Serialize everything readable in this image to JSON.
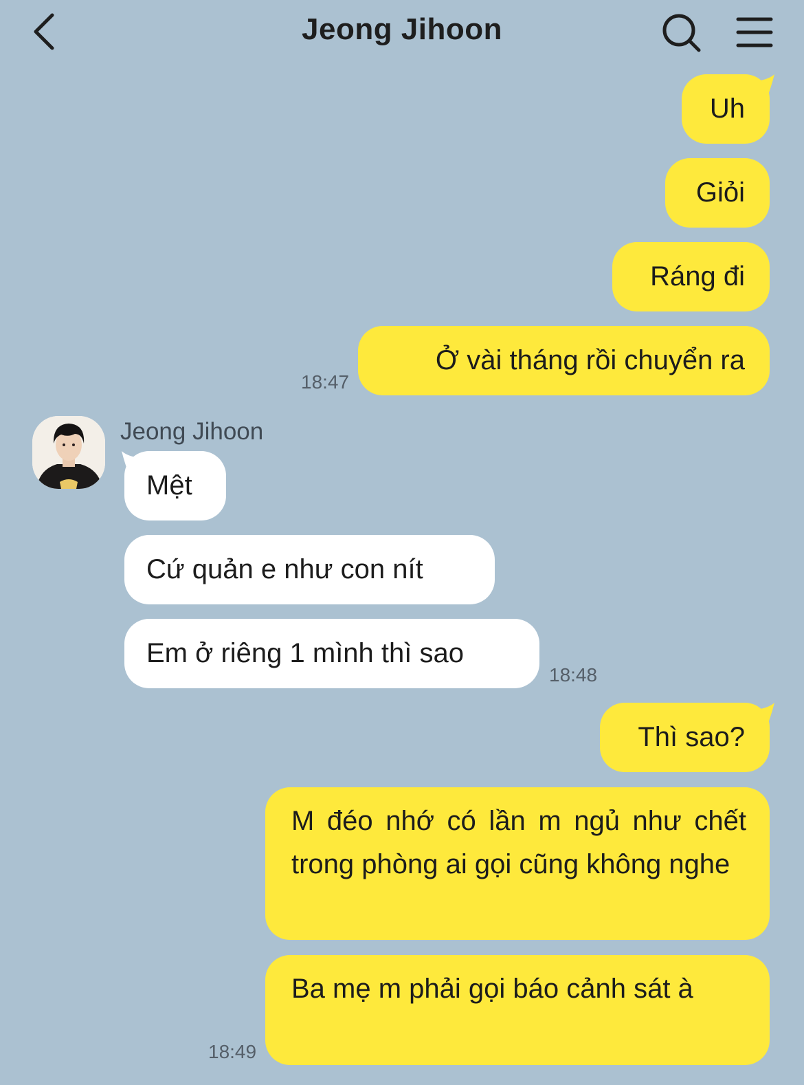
{
  "header": {
    "title": "Jeong Jihoon",
    "back_icon": "chevron-left-icon",
    "search_icon": "search-icon",
    "menu_icon": "hamburger-menu-icon"
  },
  "colors": {
    "background": "#abc1d1",
    "my_bubble": "#fee93c",
    "their_bubble": "#ffffff"
  },
  "messages": [
    {
      "from": "me",
      "text": "Uh"
    },
    {
      "from": "me",
      "text": "Giỏi"
    },
    {
      "from": "me",
      "text": "Ráng đi"
    },
    {
      "from": "me",
      "text": "Ở vài tháng rồi chuyển ra",
      "time": "18:47"
    },
    {
      "from": "Jeong Jihoon",
      "sender": "Jeong Jihoon",
      "text": "Mệt"
    },
    {
      "from": "Jeong Jihoon",
      "text": "Cứ quản e như con nít"
    },
    {
      "from": "Jeong Jihoon",
      "text": "Em ở riêng 1 mình thì sao",
      "time": "18:48"
    },
    {
      "from": "me",
      "text": "Thì sao?"
    },
    {
      "from": "me",
      "text": "M đéo nhớ có lần m ngủ như chết trong phòng ai gọi cũng không nghe"
    },
    {
      "from": "me",
      "text": "Ba mẹ m phải gọi báo cảnh sát à",
      "time": "18:49"
    }
  ]
}
